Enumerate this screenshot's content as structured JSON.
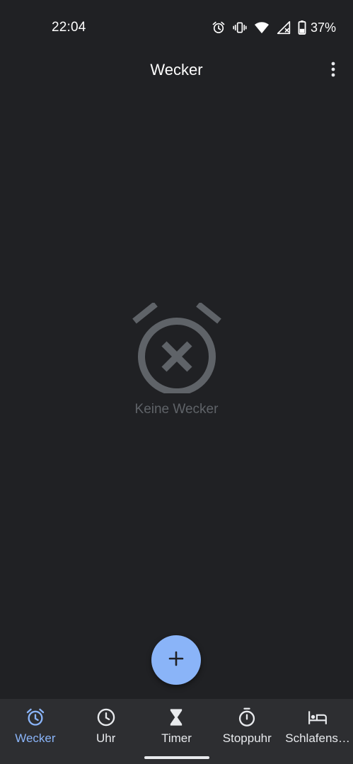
{
  "status_bar": {
    "time": "22:04",
    "icons": [
      "alarm-icon",
      "vibrate-icon",
      "wifi-icon",
      "signal-icon",
      "battery-icon"
    ],
    "battery_percent": "37%"
  },
  "app_bar": {
    "title": "Wecker",
    "menu_icon": "more-vert-icon"
  },
  "empty_state": {
    "icon": "alarm-off-icon",
    "label": "Keine Wecker"
  },
  "fab": {
    "icon": "plus-icon"
  },
  "bottom_nav": {
    "items": [
      {
        "label": "Wecker",
        "icon": "alarm-icon",
        "active": true
      },
      {
        "label": "Uhr",
        "icon": "clock-icon",
        "active": false
      },
      {
        "label": "Timer",
        "icon": "hourglass-icon",
        "active": false
      },
      {
        "label": "Stoppuhr",
        "icon": "stopwatch-icon",
        "active": false
      },
      {
        "label": "Schlafens…",
        "icon": "bed-icon",
        "active": false
      }
    ]
  },
  "colors": {
    "background": "#202124",
    "nav_background": "#2d2e31",
    "accent": "#8ab4f8",
    "muted": "#5f6368",
    "text": "#e8eaed"
  }
}
